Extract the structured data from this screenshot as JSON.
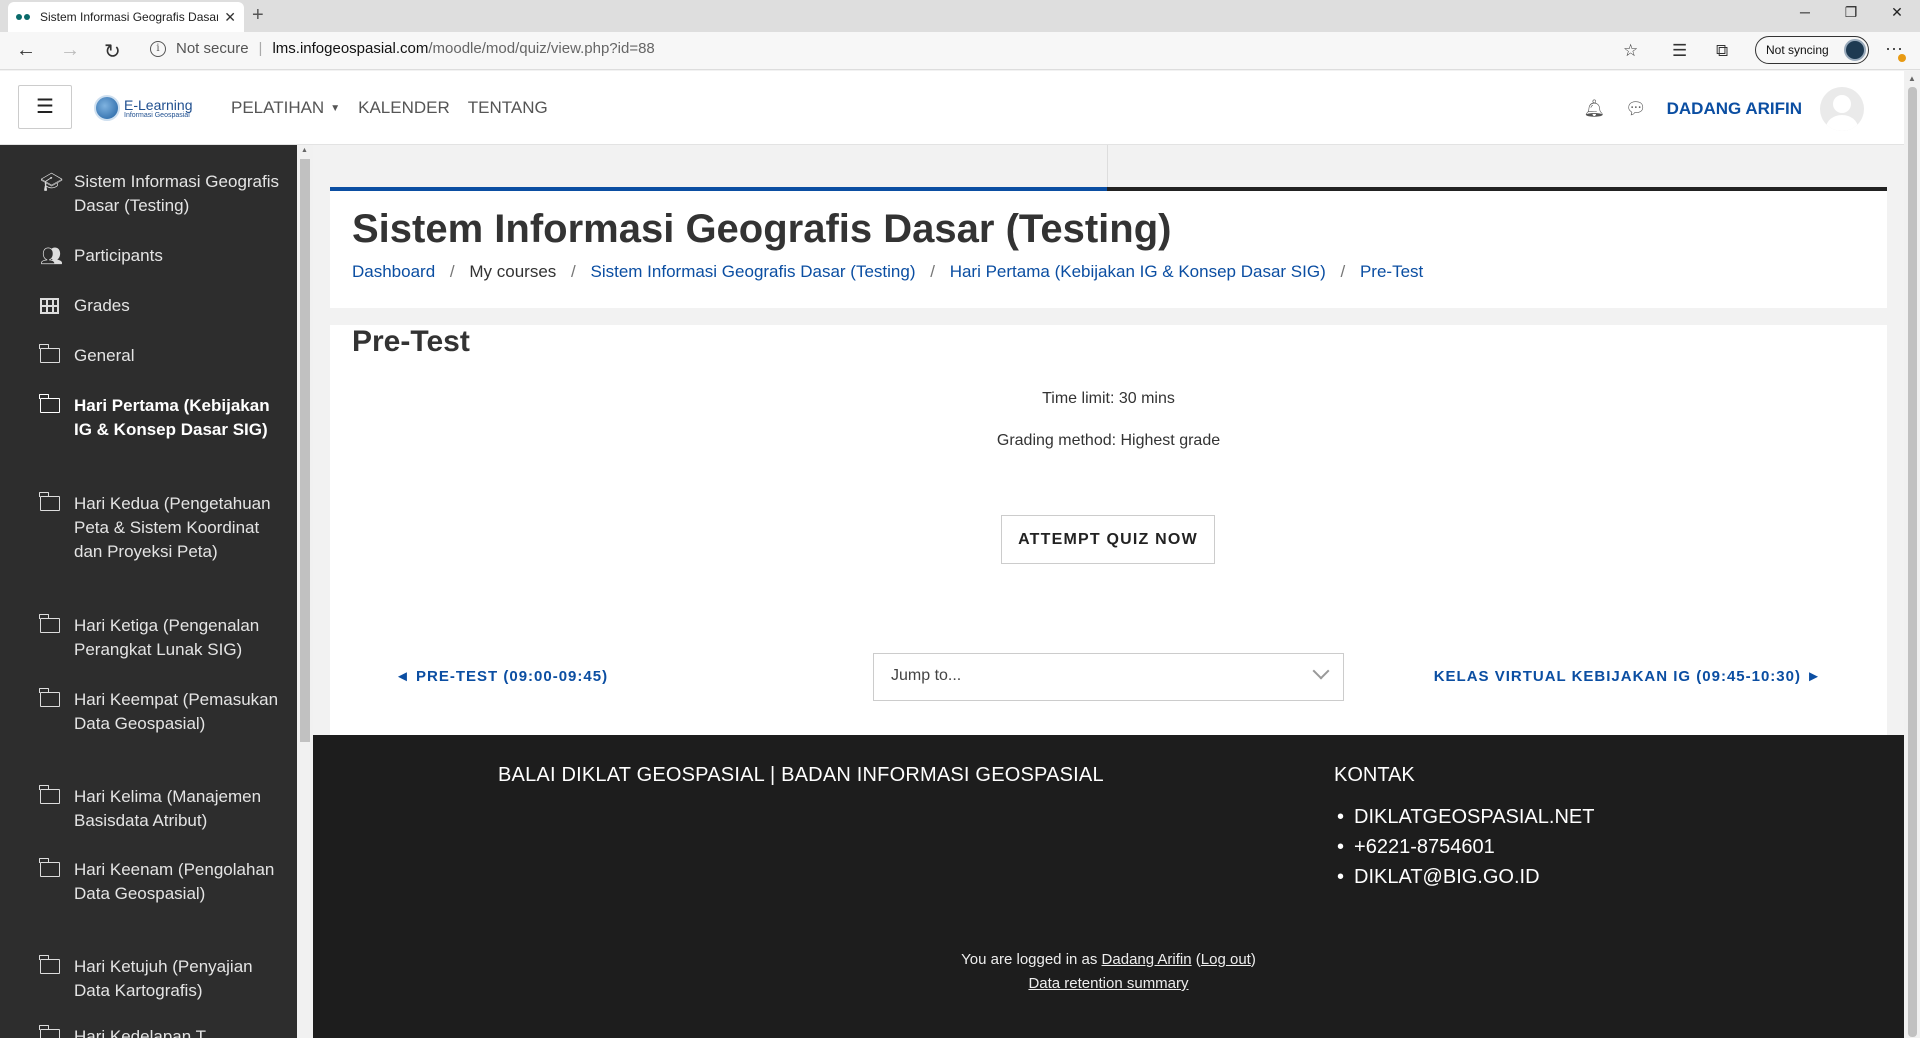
{
  "browser": {
    "tab_title": "Sistem Informasi Geografis Dasar",
    "new_tab": "+",
    "tab_close": "✕",
    "url_info": "Not secure",
    "url_host": "lms.infogeospasial.com",
    "url_path": "/moodle/mod/quiz/view.php?id=88",
    "sync_label": "Not syncing"
  },
  "navbar": {
    "logo_line1": "E-Learning",
    "logo_line2": "Informasi Geospasial",
    "menu": [
      "PELATIHAN",
      "KALENDER",
      "TENTANG"
    ],
    "user_name": "DADANG ARIFIN"
  },
  "sidebar": {
    "items": [
      {
        "label": "Sistem Informasi Geografis Dasar (Testing)",
        "icon": "graduation-cap-icon"
      },
      {
        "label": "Participants",
        "icon": "users-icon"
      },
      {
        "label": "Grades",
        "icon": "table-icon"
      },
      {
        "label": "General",
        "icon": "folder-icon"
      },
      {
        "label": "Hari Pertama (Kebijakan IG & Konsep Dasar SIG)",
        "icon": "folder-icon"
      },
      {
        "label": "Hari Kedua (Pengetahuan Peta & Sistem Koordinat dan Proyeksi Peta)",
        "icon": "folder-icon"
      },
      {
        "label": "Hari Ketiga (Pengenalan Perangkat Lunak SIG)",
        "icon": "folder-icon"
      },
      {
        "label": "Hari Keempat (Pemasukan Data Geospasial)",
        "icon": "folder-icon"
      },
      {
        "label": "Hari Kelima (Manajemen Basisdata Atribut)",
        "icon": "folder-icon"
      },
      {
        "label": "Hari Keenam (Pengolahan Data Geospasial)",
        "icon": "folder-icon"
      },
      {
        "label": "Hari Ketujuh (Penyajian Data Kartografis)",
        "icon": "folder-icon"
      },
      {
        "label": "Hari Kedelapan T...",
        "icon": "folder-icon"
      }
    ]
  },
  "header": {
    "course_title": "Sistem Informasi Geografis Dasar (Testing)",
    "breadcrumb": [
      "Dashboard",
      "My courses",
      "Sistem Informasi Geografis Dasar (Testing)",
      "Hari Pertama (Kebijakan IG & Konsep Dasar SIG)",
      "Pre-Test"
    ]
  },
  "quiz": {
    "title": "Pre-Test",
    "time_limit": "Time limit: 30 mins",
    "grading_method": "Grading method: Highest grade",
    "attempt_button": "ATTEMPT QUIZ NOW",
    "prev_link": "◄ PRE-TEST (09:00-09:45)",
    "jump_placeholder": "Jump to...",
    "next_link": "KELAS VIRTUAL KEBIJAKAN IG (09:45-10:30) ►"
  },
  "footer": {
    "org": "BALAI DIKLAT GEOSPASIAL | BADAN INFORMASI GEOSPASIAL",
    "contact_heading": "KONTAK",
    "contacts": [
      "DIKLATGEOSPASIAL.NET",
      "+6221-8754601",
      "DIKLAT@BIG.GO.ID"
    ],
    "logged_in_prefix": "You are logged in as ",
    "logged_in_user": "Dadang Arifin",
    "logout_label": "Log out",
    "retention_label": "Data retention summary"
  }
}
